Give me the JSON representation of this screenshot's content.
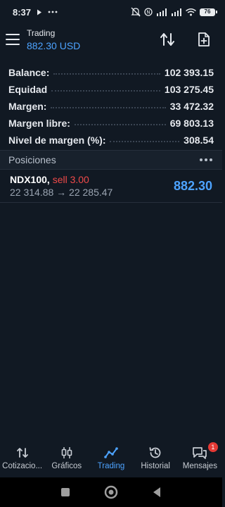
{
  "status_bar": {
    "time": "8:37",
    "battery": "76",
    "icons": [
      "play-icon",
      "more-icon",
      "mute-icon",
      "nfc-icon",
      "signal-icon",
      "signal-icon",
      "wifi-icon",
      "battery-icon"
    ]
  },
  "header": {
    "title": "Trading",
    "amount": "882.30 USD"
  },
  "summary": [
    {
      "label": "Balance:",
      "value": "102 393.15"
    },
    {
      "label": "Equidad",
      "value": "103 275.45"
    },
    {
      "label": "Margen:",
      "value": "33 472.32"
    },
    {
      "label": "Margen libre:",
      "value": "69 803.13"
    },
    {
      "label": "Nivel de margen (%):",
      "value": "308.54"
    }
  ],
  "positions": {
    "label": "Posiciones",
    "items": [
      {
        "symbol": "NDX100,",
        "side": "sell 3.00",
        "prices": "22 314.88 → 22 285.47",
        "profit": "882.30"
      }
    ]
  },
  "bottom_nav": [
    {
      "label": "Cotizacio...",
      "icon": "quotes-icon",
      "active": false
    },
    {
      "label": "Gráficos",
      "icon": "charts-icon",
      "active": false
    },
    {
      "label": "Trading",
      "icon": "trading-icon",
      "active": true
    },
    {
      "label": "Historial",
      "icon": "history-icon",
      "active": false
    },
    {
      "label": "Mensajes",
      "icon": "messages-icon",
      "active": false,
      "badge": "1"
    }
  ],
  "colors": {
    "background": "#111923",
    "accent": "#4da3ff",
    "sell": "#ef4a4a",
    "badge": "#e53935"
  }
}
